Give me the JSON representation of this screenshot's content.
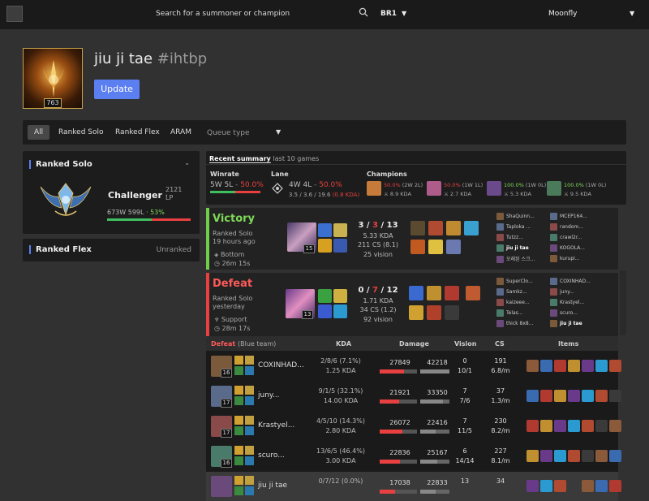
{
  "header": {
    "search_placeholder": "Search for a summoner or champion",
    "region": "BR1",
    "user": "Moonfly"
  },
  "profile": {
    "name": "jiu ji tae",
    "tag": "#ihtbp",
    "level": "763",
    "update_label": "Update"
  },
  "queue_tabs": [
    "All",
    "Ranked Solo",
    "Ranked Flex",
    "ARAM"
  ],
  "queue_type_label": "Queue type",
  "ranked_solo": {
    "title": "Ranked Solo",
    "tier": "Challenger",
    "dot": "·",
    "lp": "2121 LP",
    "wins": "673W 599L",
    "sep": "·",
    "winrate": "53%",
    "win_fraction": 0.53
  },
  "ranked_flex": {
    "title": "Ranked Flex",
    "status": "Unranked"
  },
  "summary": {
    "title": "Recent summary",
    "subtitle": "last 10 games",
    "winrate_label": "Winrate",
    "winrate_wl": "5W 5L",
    "winrate_pct": "50.0%",
    "lane_label": "Lane",
    "lane_wl": "4W 4L",
    "lane_pct": "50.0%",
    "lane_kda": "3.5 / 3.6 / 19.6",
    "lane_kda_ratio": "(0.8 KDA)",
    "champions_label": "Champions",
    "champions": [
      {
        "wr": "50.0%",
        "record": "(2W 2L)",
        "kda": "8.9 KDA",
        "color": "#c77b3a"
      },
      {
        "wr": "50.0%",
        "record": "(1W 1L)",
        "kda": "2.7 KDA",
        "color": "#b05c8a"
      },
      {
        "wr": "100.0%",
        "record": "(1W 0L)",
        "kda": "5.3 KDA",
        "color": "#6a4a8a"
      },
      {
        "wr": "100.0%",
        "record": "(1W 0L)",
        "kda": "9.5 KDA",
        "color": "#4a7a5a"
      }
    ]
  },
  "matches": [
    {
      "result": "Victory",
      "queue": "Ranked Solo",
      "ago": "19 hours ago",
      "role": "Bottom",
      "duration": "26m 15s",
      "level": "15",
      "k": "3",
      "d": "3",
      "a": "13",
      "kda": "5.33 KDA",
      "cs": "211 CS (8.1)",
      "vision": "25 vision",
      "players_left": [
        "ShaQuinn...",
        "Taploka ...",
        "Tutzz...",
        "jiu ji tae",
        "오래된 스크..."
      ],
      "players_right": [
        "MCEP164...",
        "random...",
        "crawl2r...",
        "KOGOLA...",
        "kurupi..."
      ]
    },
    {
      "result": "Defeat",
      "queue": "Ranked Solo",
      "ago": "yesterday",
      "role": "Support",
      "duration": "28m 17s",
      "level": "13",
      "k": "0",
      "d": "7",
      "a": "12",
      "kda": "1.71 KDA",
      "cs": "34 CS (1.2)",
      "vision": "92 vision",
      "players_left": [
        "SuperClo...",
        "Samkz...",
        "kaizeee...",
        "Telas...",
        "thick 8x8..."
      ],
      "players_right": [
        "COXINHAD...",
        "juny...",
        "Krastyel...",
        "scuro...",
        "jiu ji tae"
      ]
    }
  ],
  "team_table": {
    "result": "Defeat",
    "team": "(Blue team)",
    "headers": {
      "kda": "KDA",
      "damage": "Damage",
      "vision": "Vision",
      "cs": "CS",
      "items": "Items"
    },
    "rows": [
      {
        "level": "16",
        "name": "COXINHAD...",
        "kda": "2/8/6 (7.1%)",
        "ratio": "1.25 KDA",
        "dmg1": "27849",
        "dmg2": "42218",
        "vision1": "0",
        "vision2": "10/1",
        "cs": "191",
        "csm": "6.8/m"
      },
      {
        "level": "17",
        "name": "juny...",
        "kda": "9/1/5 (32.1%)",
        "ratio": "14.00 KDA",
        "dmg1": "21921",
        "dmg2": "33350",
        "vision1": "7",
        "vision2": "7/6",
        "cs": "37",
        "csm": "1.3/m"
      },
      {
        "level": "17",
        "name": "Krastyel...",
        "kda": "4/5/10 (14.3%)",
        "ratio": "2.80 KDA",
        "dmg1": "26072",
        "dmg2": "22416",
        "vision1": "7",
        "vision2": "11/5",
        "cs": "230",
        "csm": "8.2/m"
      },
      {
        "level": "16",
        "name": "scuro...",
        "kda": "13/6/5 (46.4%)",
        "ratio": "3.00 KDA",
        "dmg1": "22836",
        "dmg2": "25167",
        "vision1": "6",
        "vision2": "14/14",
        "cs": "227",
        "csm": "8.1/m"
      },
      {
        "level": "",
        "name": "jiu ji tae",
        "kda": "0/7/12 (0.0%)",
        "ratio": "",
        "dmg1": "17038",
        "dmg2": "22833",
        "vision1": "13",
        "vision2": "",
        "cs": "34",
        "csm": ""
      }
    ]
  },
  "colors": {
    "accent": "#5b7ff0",
    "win": "#7ed957",
    "loss": "#e84040",
    "victory_stripe": "#6fcf4a",
    "defeat_stripe": "#e84040"
  }
}
